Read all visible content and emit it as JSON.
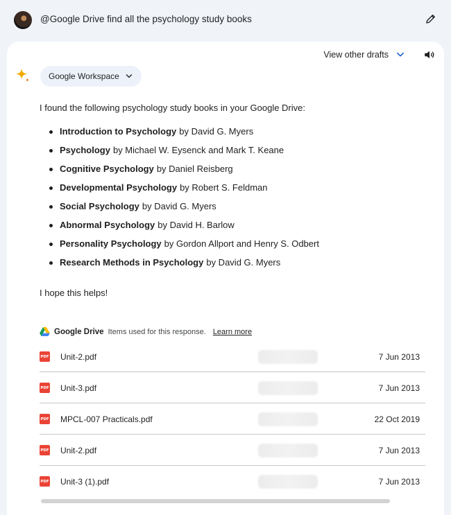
{
  "prompt": {
    "text": "@Google Drive find all the psychology study books"
  },
  "response": {
    "drafts_label": "View other drafts",
    "workspace_chip": "Google Workspace",
    "intro": "I found the following psychology study books in your Google Drive:",
    "books": [
      {
        "title": "Introduction to Psychology",
        "author": "by David G. Myers"
      },
      {
        "title": "Psychology",
        "author": "by Michael W. Eysenck and Mark T. Keane"
      },
      {
        "title": "Cognitive Psychology",
        "author": "by Daniel Reisberg"
      },
      {
        "title": "Developmental Psychology",
        "author": "by Robert S. Feldman"
      },
      {
        "title": "Social Psychology",
        "author": "by David G. Myers"
      },
      {
        "title": "Abnormal Psychology",
        "author": "by David H. Barlow"
      },
      {
        "title": "Personality Psychology",
        "author": "by Gordon Allport and Henry S. Odbert"
      },
      {
        "title": "Research Methods in Psychology",
        "author": "by David G. Myers"
      }
    ],
    "closing": "I hope this helps!"
  },
  "sources": {
    "drive_label": "Google Drive",
    "note": "Items used for this response.",
    "learn_more": "Learn more",
    "pdf_badge": "PDF",
    "files": [
      {
        "name": "Unit-2.pdf",
        "date": "7 Jun 2013"
      },
      {
        "name": "Unit-3.pdf",
        "date": "7 Jun 2013"
      },
      {
        "name": "MPCL-007 Practicals.pdf",
        "date": "22 Oct 2019"
      },
      {
        "name": "Unit-2.pdf",
        "date": "7 Jun 2013"
      },
      {
        "name": "Unit-3 (1).pdf",
        "date": "7 Jun 2013"
      }
    ]
  },
  "colors": {
    "background": "#f0f4f9",
    "card": "#ffffff",
    "accent_blue": "#0b57d0",
    "pdf_red": "#ea4335",
    "spark_gold": "#f2a900"
  },
  "icons": {
    "avatar": "user-avatar",
    "edit": "pencil-icon",
    "drafts_toggle": "chevron-down-icon",
    "speaker": "speaker-icon",
    "assistant": "sparkle-icon",
    "drive": "google-drive-icon",
    "file": "pdf-icon"
  }
}
